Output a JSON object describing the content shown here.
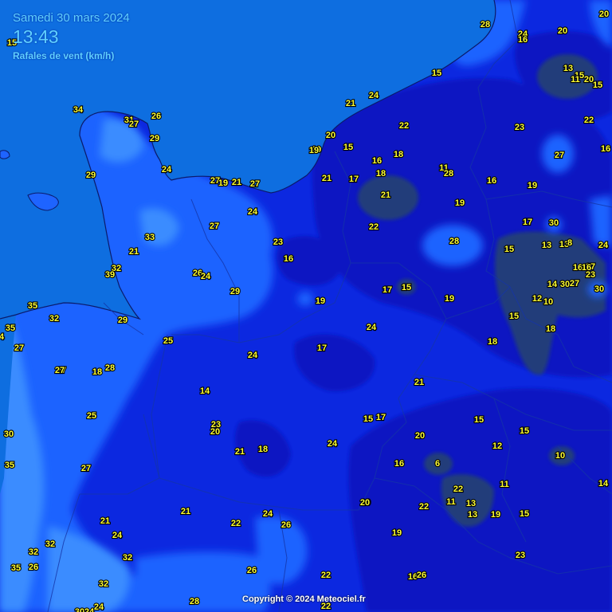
{
  "header": {
    "date": "Samedi 30 mars 2024",
    "time": "13:43",
    "parameter": "Rafales de vent (km/h)"
  },
  "copyright": "Copyright © 2024 Meteociel.fr",
  "colors": {
    "sea": "#0e6ee0",
    "gust_24_30": "#1e64ff",
    "gust_30_35": "#3a8cff",
    "gust_18_24": "#0c28e0",
    "gust_12_18": "#0718c2",
    "gust_under_12": "#213d7a",
    "label_fill": "#ffff33",
    "label_outline": "#000000"
  },
  "stations": [
    "28",
    "24",
    "16",
    "20",
    "20",
    "15",
    "34",
    "31",
    "27",
    "26",
    "29",
    "29",
    "24",
    "27",
    "19",
    "21",
    "27",
    "21",
    "24",
    "15",
    "13",
    "15",
    "11",
    "20",
    "15",
    "20",
    "21",
    "23",
    "22",
    "22",
    "19",
    "19",
    "15",
    "18",
    "16",
    "18",
    "21",
    "17",
    "11",
    "28",
    "16",
    "19",
    "16",
    "27",
    "27",
    "24",
    "22",
    "17",
    "30",
    "28",
    "15",
    "13",
    "13",
    "8",
    "24",
    "21",
    "33",
    "23",
    "16",
    "27",
    "19",
    "15",
    "19",
    "16",
    "16",
    "23",
    "14",
    "30",
    "27",
    "30",
    "12",
    "10",
    "32",
    "39",
    "26",
    "24",
    "29",
    "35",
    "32",
    "29",
    "24",
    "17",
    "18",
    "15",
    "19",
    "25",
    "17",
    "24",
    "27",
    "18",
    "28",
    "18",
    "14",
    "21",
    "15",
    "17",
    "15",
    "23",
    "20",
    "20",
    "21",
    "18",
    "24",
    "12",
    "10",
    "6",
    "15",
    "16",
    "22",
    "11",
    "14",
    "11",
    "13",
    "13",
    "19",
    "15",
    "20",
    "22",
    "26",
    "30",
    "21",
    "24",
    "20",
    "21",
    "24",
    "22",
    "32",
    "32",
    "32",
    "19",
    "35",
    "26",
    "26",
    "22",
    "16",
    "26",
    "32",
    "23",
    "22",
    "28",
    "24",
    "35",
    "30",
    "24",
    "27",
    "4",
    "35",
    "25",
    "27",
    "27"
  ]
}
